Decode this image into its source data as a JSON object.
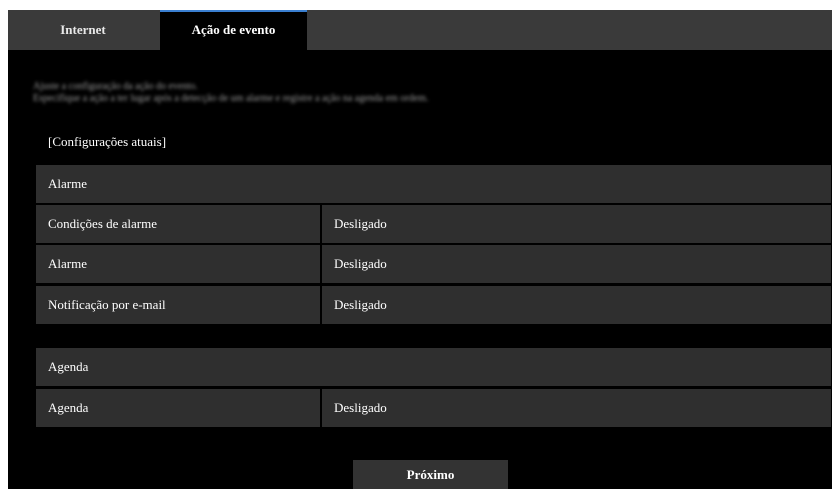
{
  "tabs": [
    {
      "label": "Internet",
      "active": false
    },
    {
      "label": "Ação de evento",
      "active": true
    }
  ],
  "description": {
    "line1": "Ajuste a configuração da ação do evento.",
    "line2": "Especifique a ação a ter lugar após a detecção de um alarme e registre a ação na agenda em ordem."
  },
  "current_settings_title": "[Configurações atuais]",
  "alarm_section": {
    "header": "Alarme",
    "rows": [
      {
        "label": "Condições de alarme",
        "value": "Desligado"
      },
      {
        "label": "Alarme",
        "value": "Desligado"
      },
      {
        "label": "Notificação por e-mail",
        "value": "Desligado"
      }
    ]
  },
  "schedule_section": {
    "header": "Agenda",
    "rows": [
      {
        "label": "Agenda",
        "value": "Desligado"
      }
    ]
  },
  "next_button": "Próximo",
  "colors": {
    "background": "#000000",
    "tab_bar": "#3a3a3a",
    "row_background": "#2f2f2f",
    "active_tab_accent": "#3a7fd0"
  }
}
